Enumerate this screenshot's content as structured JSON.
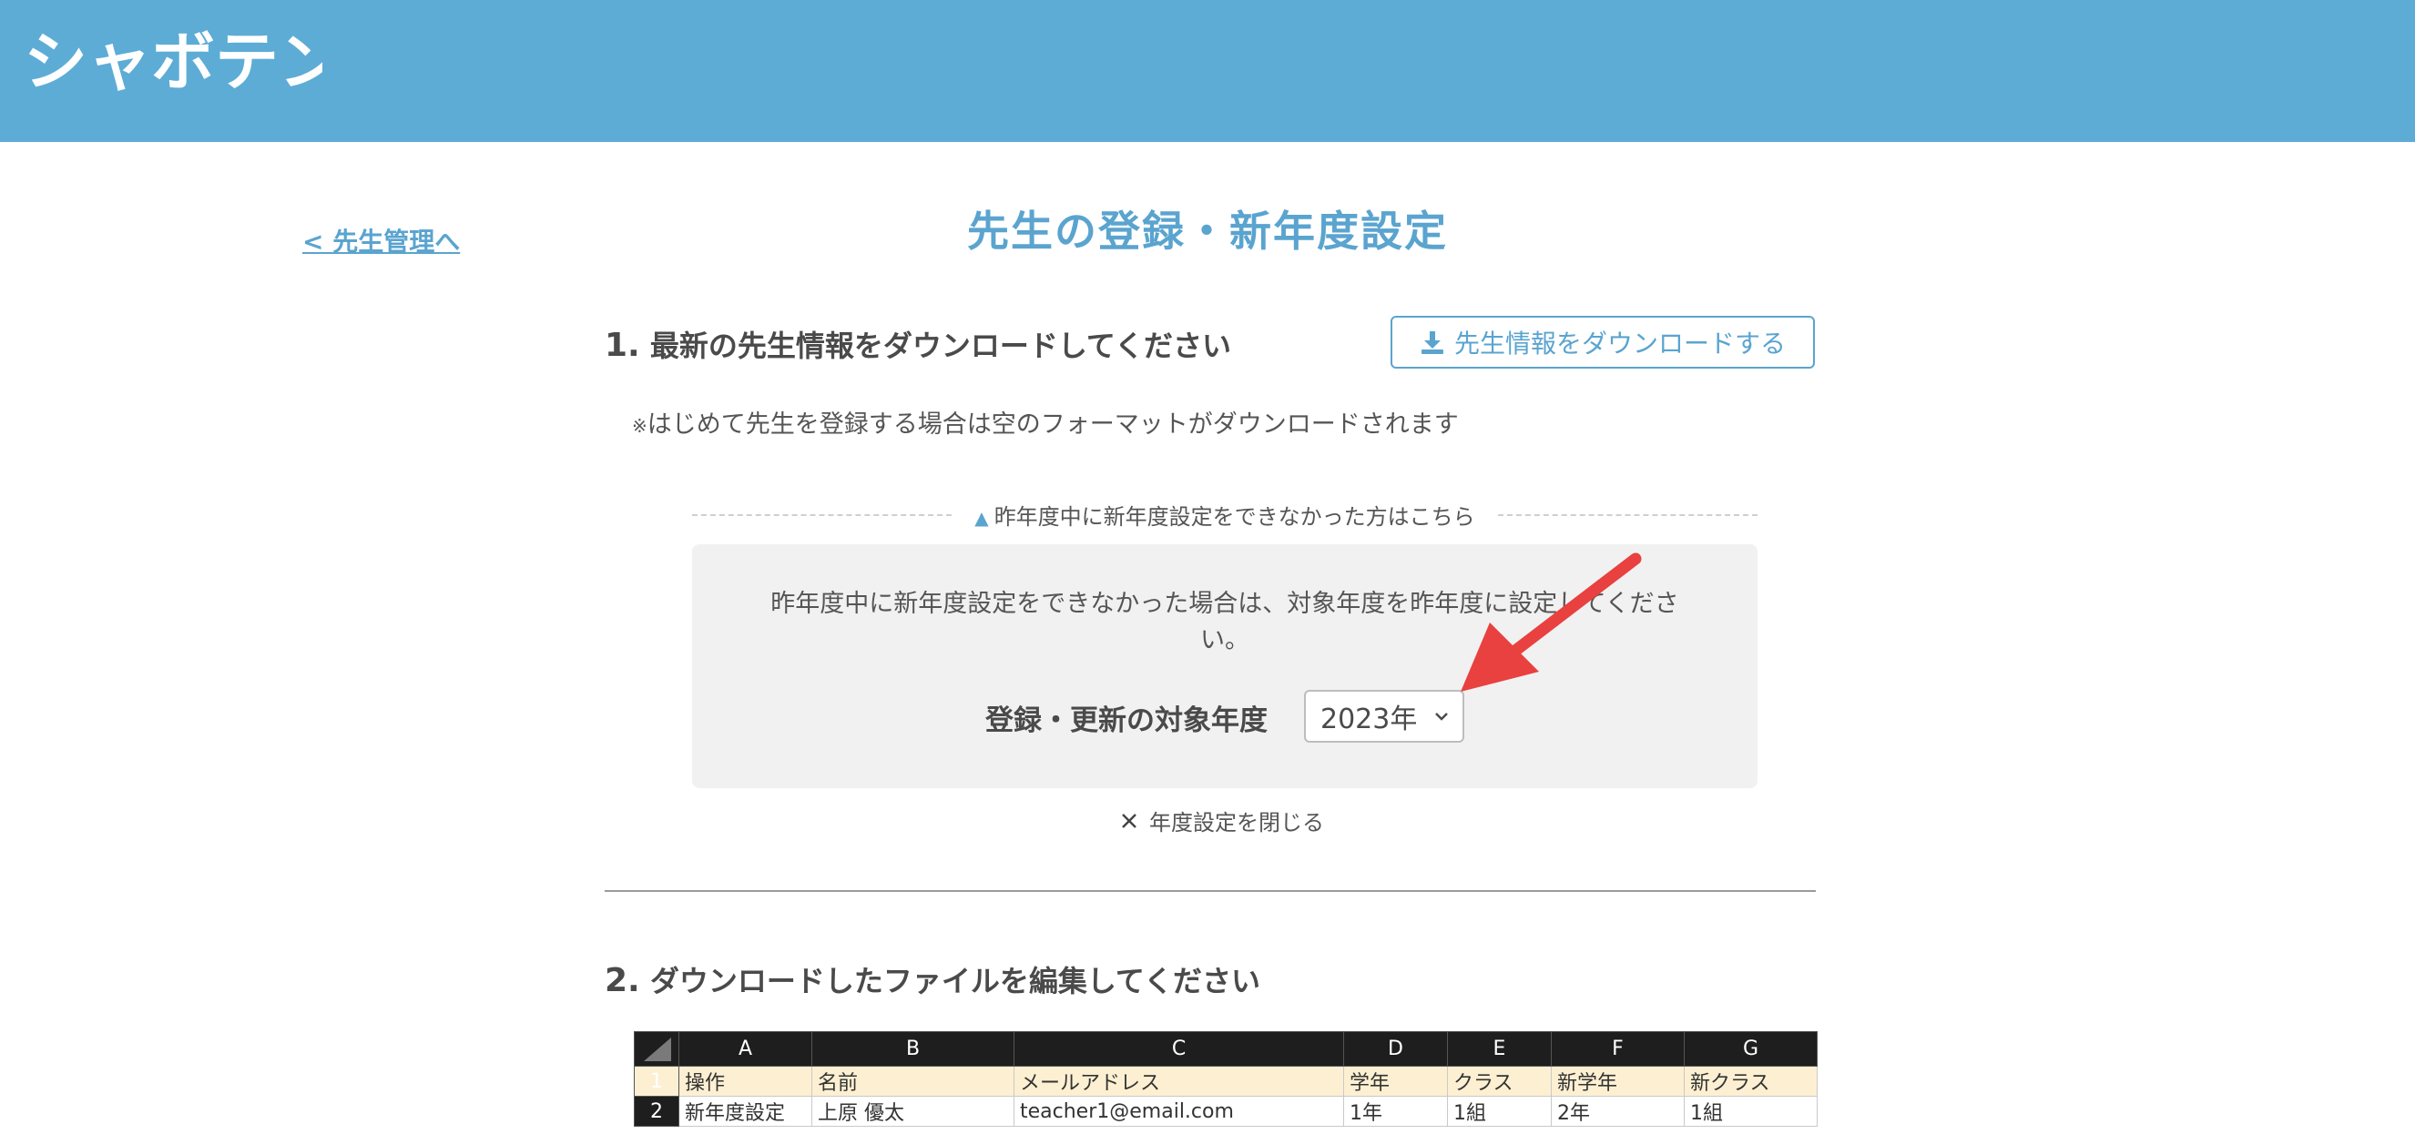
{
  "header": {
    "logo_text": "シャボテン",
    "color": "#5dacd6"
  },
  "back_link": "< 先生管理へ",
  "page_title": "先生の登録・新年度設定",
  "step1": {
    "number": "1.",
    "title": "最新の先生情報をダウンロードしてください",
    "download_button": "先生情報をダウンロードする",
    "download_icon": "download-icon",
    "note_prefix": "※",
    "note": "はじめて先生を登録する場合は空のフォーマットがダウンロードされます"
  },
  "prev_year": {
    "toggle_icon": "▲",
    "toggle_text": "昨年度中に新年度設定をできなかった方はこちら",
    "description": "昨年度中に新年度設定をできなかった場合は、対象年度を昨年度に設定してください。",
    "year_label": "登録・更新の対象年度",
    "selected_year": "2023年",
    "close_text": "年度設定を閉じる"
  },
  "step2": {
    "number": "2.",
    "title": "ダウンロードしたファイルを編集してください"
  },
  "sheet": {
    "columns": [
      "A",
      "B",
      "C",
      "D",
      "E",
      "F",
      "G"
    ],
    "rows": [
      {
        "num": "1",
        "cells": [
          "操作",
          "名前",
          "メールアドレス",
          "学年",
          "クラス",
          "新学年",
          "新クラス"
        ]
      },
      {
        "num": "2",
        "cells": [
          "新年度設定",
          "上原 優太",
          "teacher1@email.com",
          "1年",
          "1組",
          "2年",
          "1組"
        ]
      }
    ]
  },
  "colors": {
    "accent": "#5aa4cf",
    "arrow": "#e8413f",
    "sheet_header_row": "#fdf0d2"
  }
}
